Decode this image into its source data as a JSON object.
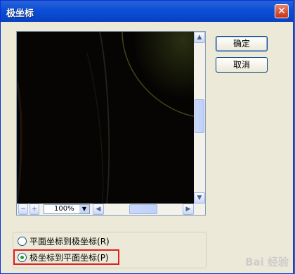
{
  "window": {
    "title": "极坐标",
    "close_glyph": "✕"
  },
  "buttons": {
    "ok": "确定",
    "cancel": "取消"
  },
  "preview": {
    "zoom_out": "−",
    "zoom_in": "+",
    "zoom_value": "100%"
  },
  "options": [
    {
      "label": "平面坐标到极坐标",
      "key": "(R)",
      "selected": false
    },
    {
      "label": "极坐标到平面坐标",
      "key": "(P)",
      "selected": true
    }
  ],
  "watermark": "Bai 经验"
}
